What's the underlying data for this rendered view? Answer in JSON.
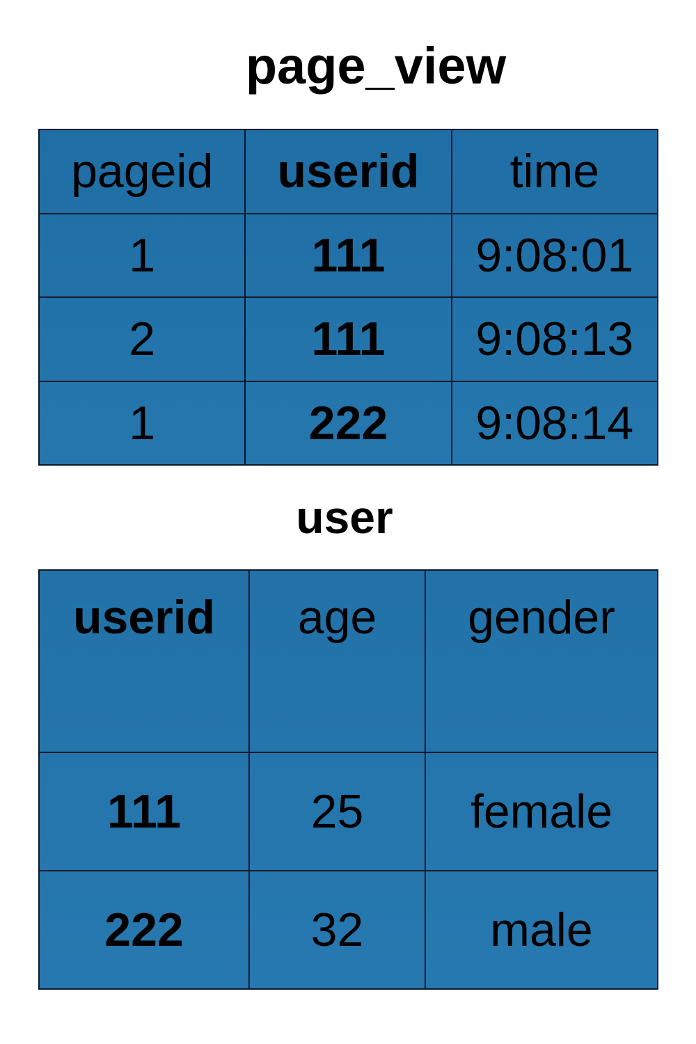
{
  "tables": [
    {
      "title": "page_view",
      "columns": [
        "pageid",
        "userid",
        "time"
      ],
      "key_column": "userid",
      "rows": [
        [
          "1",
          "111",
          "9:08:01"
        ],
        [
          "2",
          "111",
          "9:08:13"
        ],
        [
          "1",
          "222",
          "9:08:14"
        ]
      ]
    },
    {
      "title": "user",
      "columns": [
        "userid",
        "age",
        "gender"
      ],
      "key_column": "userid",
      "rows": [
        [
          "111",
          "25",
          "female"
        ],
        [
          "222",
          "32",
          "male"
        ]
      ]
    }
  ],
  "colors": {
    "table_fill": "#2474aa",
    "border": "#0a1a2a",
    "text": "#000000",
    "background": "#ffffff"
  }
}
